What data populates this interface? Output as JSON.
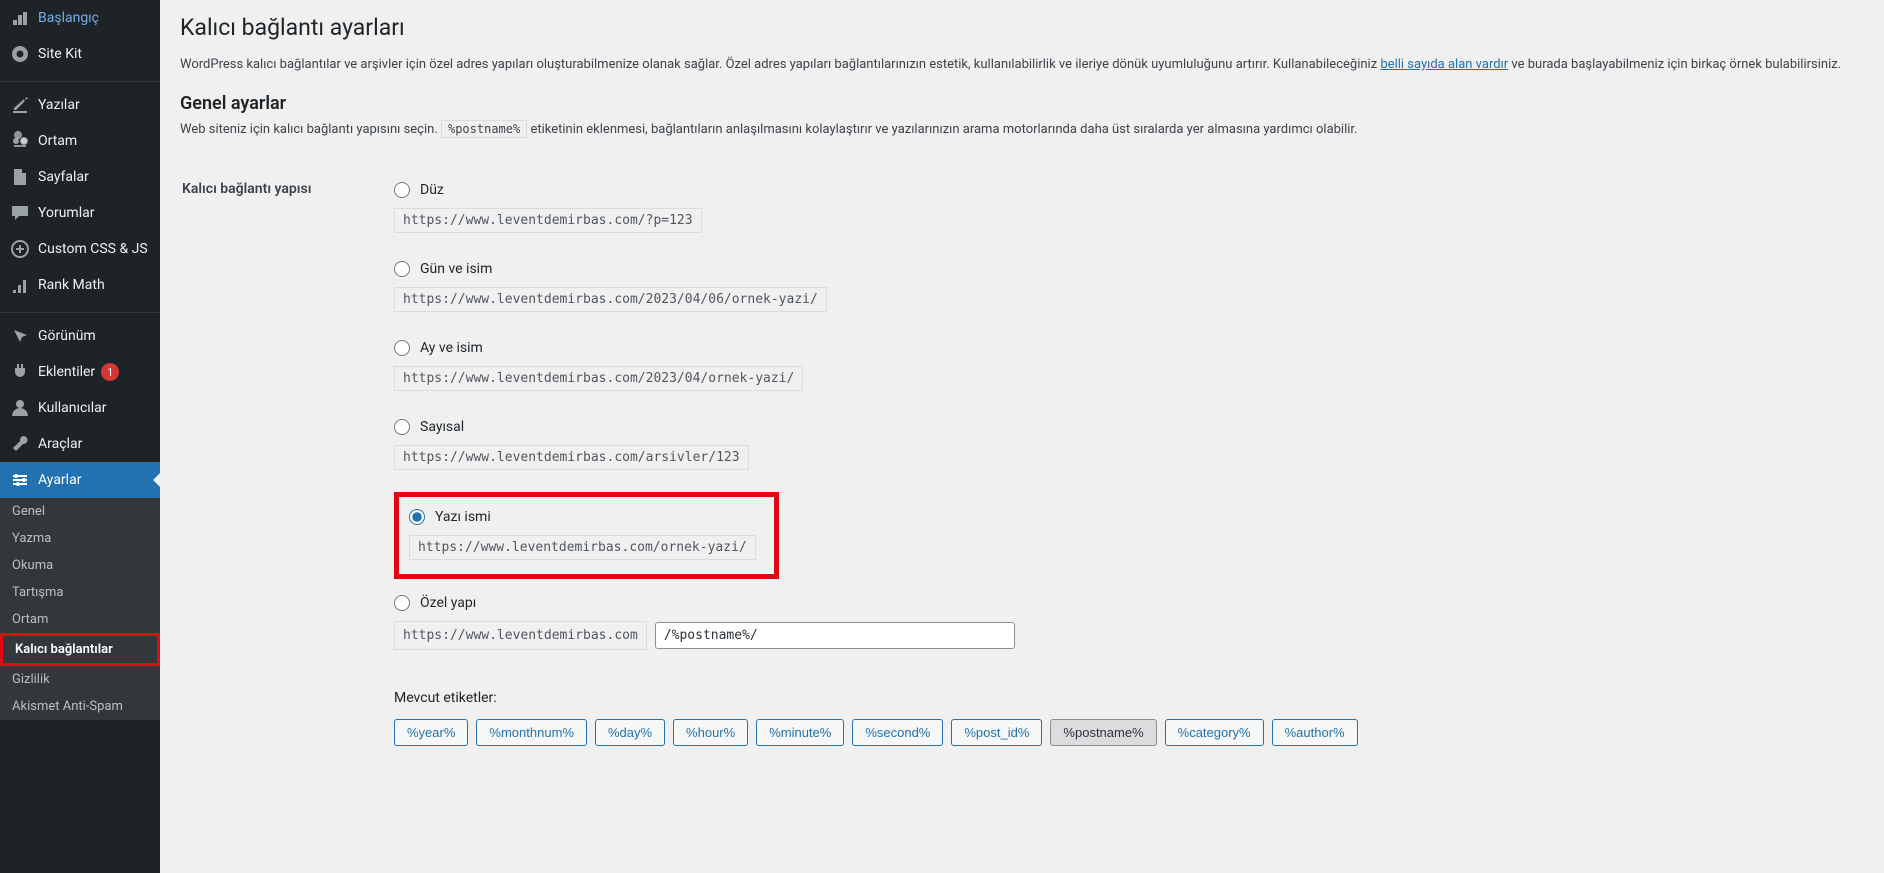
{
  "sidebar": {
    "items": [
      {
        "id": "dashboard",
        "label": "Başlangıç"
      },
      {
        "id": "sitekit",
        "label": "Site Kit"
      },
      {
        "id": "sep1",
        "sep": true
      },
      {
        "id": "posts",
        "label": "Yazılar"
      },
      {
        "id": "media",
        "label": "Ortam"
      },
      {
        "id": "pages",
        "label": "Sayfalar"
      },
      {
        "id": "comments",
        "label": "Yorumlar"
      },
      {
        "id": "customcss",
        "label": "Custom CSS & JS"
      },
      {
        "id": "rankmath",
        "label": "Rank Math"
      },
      {
        "id": "sep2",
        "sep": true
      },
      {
        "id": "appearance",
        "label": "Görünüm"
      },
      {
        "id": "plugins",
        "label": "Eklentiler",
        "badge": "1"
      },
      {
        "id": "users",
        "label": "Kullanıcılar"
      },
      {
        "id": "tools",
        "label": "Araçlar"
      },
      {
        "id": "settings",
        "label": "Ayarlar",
        "current": true
      }
    ],
    "submenu": [
      {
        "id": "general",
        "label": "Genel"
      },
      {
        "id": "writing",
        "label": "Yazma"
      },
      {
        "id": "reading",
        "label": "Okuma"
      },
      {
        "id": "discussion",
        "label": "Tartışma"
      },
      {
        "id": "media",
        "label": "Ortam"
      },
      {
        "id": "permalinks",
        "label": "Kalıcı bağlantılar",
        "current": true,
        "highlighted": true
      },
      {
        "id": "privacy",
        "label": "Gizlilik"
      },
      {
        "id": "akismet",
        "label": "Akismet Anti-Spam"
      }
    ]
  },
  "main": {
    "title": "Kalıcı bağlantı ayarları",
    "intro_before": "WordPress kalıcı bağlantılar ve arşivler için özel adres yapıları oluşturabilmenize olanak sağlar. Özel adres yapıları bağlantılarınızın estetik, kullanılabilirlik ve ileriye dönük uyumluluğunu artırır. Kullanabileceğiniz ",
    "intro_link": "belli sayıda alan vardır",
    "intro_after": " ve burada başlayabilmeniz için birkaç örnek bulabilirsiniz.",
    "common_heading": "Genel ayarlar",
    "common_help_before": "Web siteniz için kalıcı bağlantı yapısını seçin. ",
    "common_help_code": "%postname%",
    "common_help_after": " etiketinin eklenmesi, bağlantıların anlaşılmasını kolaylaştırır ve yazılarınızın arama motorlarında daha üst sıralarda yer almasına yardımcı olabilir.",
    "structure_label": "Kalıcı bağlantı yapısı",
    "options": [
      {
        "id": "plain",
        "label": "Düz",
        "example": "https://www.leventdemirbas.com/?p=123"
      },
      {
        "id": "dayname",
        "label": "Gün ve isim",
        "example": "https://www.leventdemirbas.com/2023/04/06/ornek-yazi/"
      },
      {
        "id": "monthname",
        "label": "Ay ve isim",
        "example": "https://www.leventdemirbas.com/2023/04/ornek-yazi/"
      },
      {
        "id": "numeric",
        "label": "Sayısal",
        "example": "https://www.leventdemirbas.com/arsivler/123"
      },
      {
        "id": "postname",
        "label": "Yazı ismi",
        "example": "https://www.leventdemirbas.com/ornek-yazi/",
        "checked": true,
        "highlighted": true
      },
      {
        "id": "custom",
        "label": "Özel yapı",
        "custom": true,
        "prefix": "https://www.leventdemirbas.com",
        "value": "/%postname%/"
      }
    ],
    "tags_label": "Mevcut etiketler:",
    "tags": [
      {
        "label": "%year%"
      },
      {
        "label": "%monthnum%"
      },
      {
        "label": "%day%"
      },
      {
        "label": "%hour%"
      },
      {
        "label": "%minute%"
      },
      {
        "label": "%second%"
      },
      {
        "label": "%post_id%"
      },
      {
        "label": "%postname%",
        "active": true
      },
      {
        "label": "%category%"
      },
      {
        "label": "%author%"
      }
    ]
  }
}
